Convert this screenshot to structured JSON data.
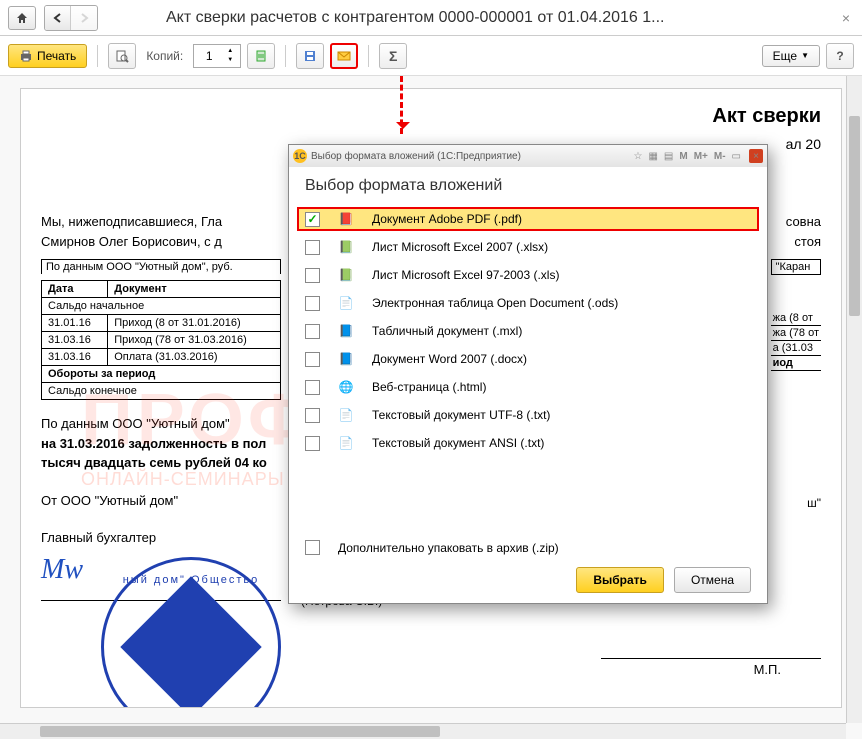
{
  "window": {
    "title": "Акт сверки расчетов с контрагентом 0000-000001 от 01.04.2016 1..."
  },
  "toolbar": {
    "print": "Печать",
    "copies_label": "Копий:",
    "copies_value": "1",
    "more": "Еще",
    "help": "?"
  },
  "document": {
    "title_partial": "Акт сверки",
    "date_partial": "ал 20",
    "para1_left": "Мы, нижеподписавшиеся, Гла",
    "para1_right": "совна",
    "para2_left": "Смирнов Олег Борисович, с д",
    "para2_right": "стоя",
    "table_caption": "По данным ООО \"Уютный дом\", руб.",
    "right_caption": "\"Каран",
    "headers": [
      "Дата",
      "Документ"
    ],
    "rows": [
      {
        "date": "",
        "doc": "Сальдо начальное",
        "span": true
      },
      {
        "date": "31.01.16",
        "doc": "Приход (8 от 31.01.2016)"
      },
      {
        "date": "31.03.16",
        "doc": "Приход (78 от 31.03.2016)"
      },
      {
        "date": "31.03.16",
        "doc": "Оплата (31.03.2016)"
      }
    ],
    "right_rows": [
      "жа (8 от",
      "жа (78 от",
      "а (31.03"
    ],
    "turnover": "Обороты за период",
    "closing": "Сальдо конечное",
    "right_turnover": "иод",
    "footer1": "По данным ООО \"Уютный дом\"",
    "footer2": "на 31.03.2016 задолженность в пол",
    "footer3": "тысяч двадцать семь рублей 04 ко",
    "from": "От ООО \"Уютный дом\"",
    "role": "Главный бухгалтер",
    "right_from_partial": "ш\"",
    "sig_name": "(Петрова С.Б.)",
    "mp": "М.П.",
    "stamp_text": "ный дом\" Общество"
  },
  "dialog": {
    "window_title": "Выбор формата вложений  (1С:Предприятие)",
    "header": "Выбор формата вложений",
    "formats": [
      {
        "label": "Документ Adobe PDF (.pdf)",
        "icon": "📕",
        "checked": true,
        "selected": true
      },
      {
        "label": "Лист Microsoft Excel 2007 (.xlsx)",
        "icon": "📗",
        "checked": false
      },
      {
        "label": "Лист Microsoft Excel 97-2003 (.xls)",
        "icon": "📗",
        "checked": false
      },
      {
        "label": "Электронная таблица Open Document (.ods)",
        "icon": "📄",
        "checked": false
      },
      {
        "label": "Табличный документ (.mxl)",
        "icon": "📘",
        "checked": false
      },
      {
        "label": "Документ Word 2007 (.docx)",
        "icon": "📘",
        "checked": false
      },
      {
        "label": "Веб-страница (.html)",
        "icon": "🌐",
        "checked": false
      },
      {
        "label": "Текстовый документ UTF-8 (.txt)",
        "icon": "📄",
        "checked": false
      },
      {
        "label": "Текстовый документ ANSI (.txt)",
        "icon": "📄",
        "checked": false
      }
    ],
    "zip_label": "Дополнительно упаковать в архив (.zip)",
    "select": "Выбрать",
    "cancel": "Отмена"
  },
  "watermark": {
    "big": "ПРОФБУХ8.РУ",
    "small": "ОНЛАЙН-СЕМИНАРЫ И ВИДЕОКУРСЫ 1С:8"
  }
}
